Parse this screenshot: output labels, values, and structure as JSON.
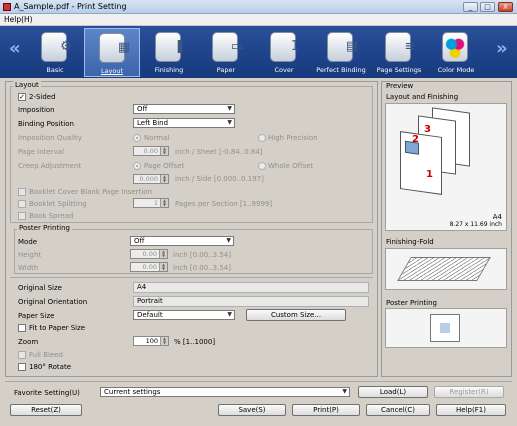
{
  "window": {
    "title": "A_Sample.pdf - Print Setting",
    "minimize": "_",
    "maximize": "□",
    "close": "X"
  },
  "menu": {
    "help": "Help(H)"
  },
  "toolbar": {
    "left_arrow": "«",
    "right_arrow": "»",
    "items": [
      {
        "label": "Basic",
        "icon": "basic-icon",
        "glyph": "⚙"
      },
      {
        "label": "Layout",
        "icon": "layout-icon",
        "glyph": "▦"
      },
      {
        "label": "Finishing",
        "icon": "finishing-icon",
        "glyph": "❚"
      },
      {
        "label": "Paper",
        "icon": "paper-icon",
        "glyph": "▭"
      },
      {
        "label": "Cover",
        "icon": "cover-icon",
        "glyph": "1"
      },
      {
        "label": "Perfect Binding",
        "icon": "perfect-binding-icon",
        "glyph": "▤"
      },
      {
        "label": "Page Settings",
        "icon": "page-settings-icon",
        "glyph": "≡"
      },
      {
        "label": "Color Mode",
        "icon": "color-mode-icon",
        "glyph": "●"
      }
    ]
  },
  "layout": {
    "group_title": "Layout",
    "two_sided": "2-Sided",
    "imposition_label": "Imposition",
    "imposition_value": "Off",
    "binding_label": "Binding Position",
    "binding_value": "Left Bind",
    "imposition_quality_label": "Imposition Quality",
    "quality_normal": "Normal",
    "quality_high": "High Precision",
    "page_interval_label": "Page Interval",
    "page_interval_value": "0.00",
    "page_interval_unit": "inch / Sheet [-0.84..0.84]",
    "creep_label": "Creep Adjustment",
    "creep_page_offset": "Page Offset",
    "creep_whole_offset": "Whole Offset",
    "creep_value": "0.000",
    "creep_unit": "inch / Side [0.000..0.197]",
    "booklet_cover": "Booklet Cover Blank Page Insertion",
    "booklet_splitting": "Booklet Splitting",
    "pages_per_section_value": "1",
    "pages_per_section": "Pages per Section [1..9999]",
    "book_spread": "Book Spread"
  },
  "poster": {
    "group_title": "Poster Printing",
    "mode_label": "Mode",
    "mode_value": "Off",
    "height_label": "Height",
    "height_value": "0.00",
    "height_unit": "inch [0.00..3.54]",
    "width_label": "Width",
    "width_value": "0.00",
    "width_unit": "inch [0.00..3.54]"
  },
  "size": {
    "original_size_label": "Original Size",
    "original_size_value": "A4",
    "orientation_label": "Original Orientation",
    "orientation_value": "Portrait",
    "paper_size_label": "Paper Size",
    "paper_size_value": "Default",
    "custom_size_button": "Custom Size...",
    "fit_to_paper": "Fit to Paper Size",
    "zoom_label": "Zoom",
    "zoom_value": "100",
    "zoom_unit": "% [1..1000]",
    "full_bleed": "Full Bleed",
    "rotate": "180°  Rotate"
  },
  "preview": {
    "title": "Preview",
    "layout_finishing": "Layout and Finishing",
    "paper_name": "A4",
    "paper_dims": "8.27 x 11.69 inch",
    "page_numbers": [
      "3",
      "2",
      "1"
    ],
    "finishing_fold": "Finishing-Fold",
    "poster_printing": "Poster Printing"
  },
  "favorite": {
    "label": "Favorite Setting(U)",
    "value": "Current settings",
    "load": "Load(L)",
    "register": "Register(R)"
  },
  "footer": {
    "reset": "Reset(Z)",
    "save": "Save(S)",
    "print": "Print(P)",
    "cancel": "Cancel(C)",
    "help": "Help(F1)"
  },
  "colors": {
    "toolbar_bg": "#1f4589",
    "accent": "#c00000"
  }
}
